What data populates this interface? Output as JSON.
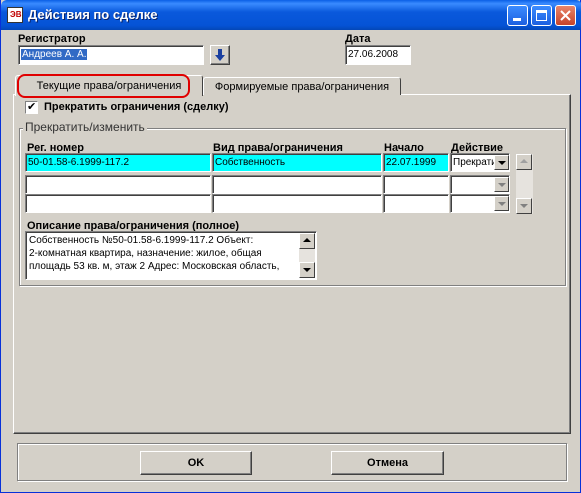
{
  "window": {
    "title": "Действия по сделке",
    "app_icon_text": "ЭВ"
  },
  "registrar": {
    "label": "Регистратор",
    "value": "Андреев А. А."
  },
  "date": {
    "label": "Дата",
    "value": "27.06.2008"
  },
  "tabs": [
    {
      "label": "Текущие права/ограничения",
      "active": true
    },
    {
      "label": "Формируемые права/ограничения",
      "active": false
    }
  ],
  "terminate_checkbox": {
    "label": "Прекратить ограничения (сделку)",
    "checked": true,
    "check_glyph": "✔"
  },
  "group": {
    "title": "Прекратить/изменить"
  },
  "table": {
    "columns": [
      "Рег. номер",
      "Вид права/ограничения",
      "Начало",
      "Действие"
    ],
    "rows": [
      {
        "reg_number": "50-01.58-6.1999-117.2",
        "right_type": "Собственность",
        "start": "22.07.1999",
        "action": "Прекратить"
      },
      {
        "reg_number": "",
        "right_type": "",
        "start": "",
        "action": ""
      },
      {
        "reg_number": "",
        "right_type": "",
        "start": "",
        "action": ""
      }
    ]
  },
  "description": {
    "label": "Описание права/ограничения (полное)",
    "lines": [
      "Собственность №50-01.58-6.1999-117.2 Объект:",
      "2-комнатная квартира, назначение: жилое, общая",
      "площадь 53 кв. м, этаж 2 Адрес: Московская область,"
    ]
  },
  "buttons": {
    "ok": "OK",
    "cancel": "Отмена"
  },
  "colors": {
    "selected_row": "#00ffff",
    "titlebar": "#0a59dc",
    "highlight_ring": "#e00000"
  }
}
